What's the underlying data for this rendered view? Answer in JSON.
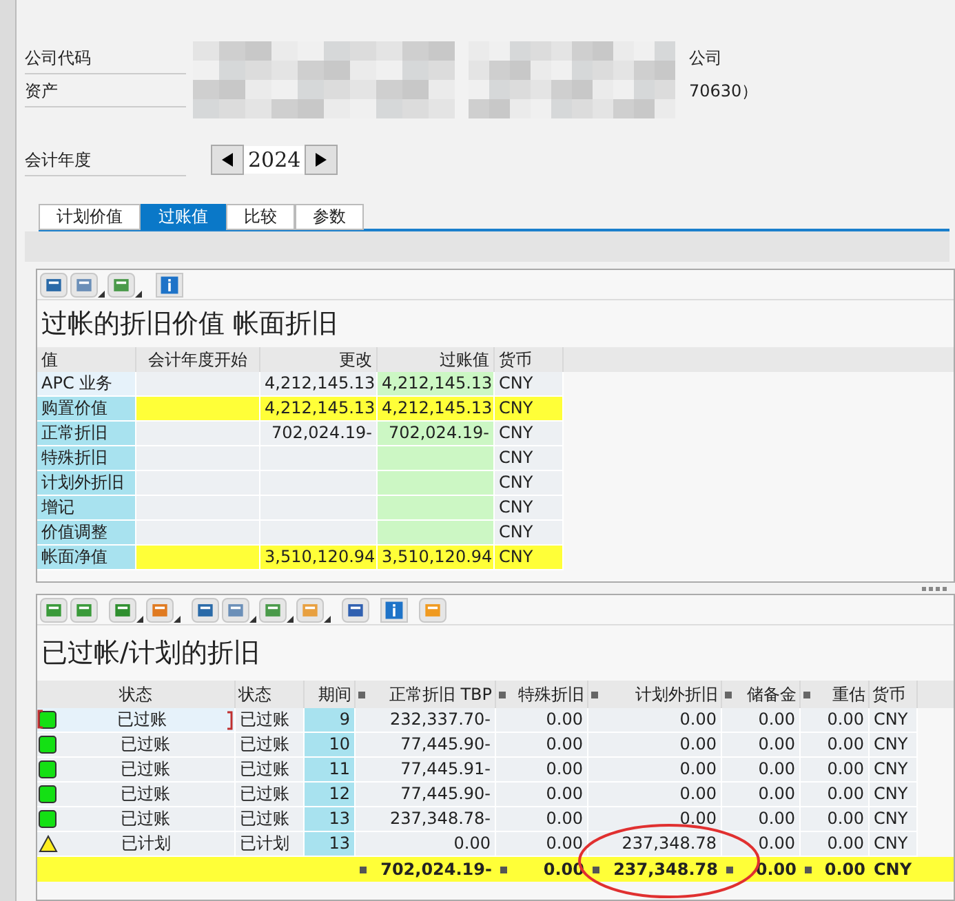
{
  "header": {
    "fields": [
      {
        "label": "公司代码",
        "value": "公司"
      },
      {
        "label": "资产",
        "value": "70630）"
      }
    ],
    "year": {
      "label": "会计年度",
      "value": "2024"
    }
  },
  "tabs": [
    {
      "label": "计划价值",
      "selected": false
    },
    {
      "label": "过账值",
      "selected": true
    },
    {
      "label": "比较",
      "selected": false
    },
    {
      "label": "参数",
      "selected": false
    }
  ],
  "values_panel": {
    "title": "过帐的折旧价值 帐面折旧",
    "columns": [
      "值",
      "会计年度开始",
      "更改",
      "过账值",
      "货币"
    ],
    "rows": [
      {
        "kind": "group",
        "highlight": false,
        "cells": [
          "APC 业务",
          "",
          "4,212,145.13",
          "4,212,145.13",
          "CNY"
        ]
      },
      {
        "kind": "value",
        "highlight": true,
        "cells": [
          "购置价值",
          "",
          "4,212,145.13",
          "4,212,145.13",
          "CNY"
        ]
      },
      {
        "kind": "value",
        "highlight": false,
        "cells": [
          "正常折旧",
          "",
          "702,024.19-",
          "702,024.19-",
          "CNY"
        ]
      },
      {
        "kind": "value",
        "highlight": false,
        "cells": [
          "特殊折旧",
          "",
          "",
          "",
          "CNY"
        ]
      },
      {
        "kind": "value",
        "highlight": false,
        "cells": [
          "计划外折旧",
          "",
          "",
          "",
          "CNY"
        ]
      },
      {
        "kind": "value",
        "highlight": false,
        "cells": [
          "增记",
          "",
          "",
          "",
          "CNY"
        ]
      },
      {
        "kind": "value",
        "highlight": false,
        "cells": [
          "价值调整",
          "",
          "",
          "",
          "CNY"
        ]
      },
      {
        "kind": "value",
        "highlight": true,
        "cells": [
          "帐面净值",
          "",
          "3,510,120.94",
          "3,510,120.94",
          "CNY"
        ]
      }
    ]
  },
  "depreciation_panel": {
    "title": "已过帐/计划的折旧",
    "columns": [
      {
        "label": "状态",
        "sum": false
      },
      {
        "label": "状态",
        "sum": false
      },
      {
        "label": "期间",
        "sum": false
      },
      {
        "label": "正常折旧 TBP",
        "sum": true
      },
      {
        "label": "特殊折旧",
        "sum": true
      },
      {
        "label": "计划外折旧",
        "sum": true
      },
      {
        "label": "储备金",
        "sum": true
      },
      {
        "label": "重估",
        "sum": true
      },
      {
        "label": "货币",
        "sum": false
      }
    ],
    "rows": [
      {
        "kind": "posted",
        "selected": true,
        "cells": [
          "已过账",
          "已过账",
          "9",
          "232,337.70-",
          "0.00",
          "0.00",
          "0.00",
          "0.00",
          "CNY"
        ]
      },
      {
        "kind": "posted",
        "selected": false,
        "cells": [
          "已过账",
          "已过账",
          "10",
          "77,445.90-",
          "0.00",
          "0.00",
          "0.00",
          "0.00",
          "CNY"
        ]
      },
      {
        "kind": "posted",
        "selected": false,
        "cells": [
          "已过账",
          "已过账",
          "11",
          "77,445.91-",
          "0.00",
          "0.00",
          "0.00",
          "0.00",
          "CNY"
        ]
      },
      {
        "kind": "posted",
        "selected": false,
        "cells": [
          "已过账",
          "已过账",
          "12",
          "77,445.90-",
          "0.00",
          "0.00",
          "0.00",
          "0.00",
          "CNY"
        ]
      },
      {
        "kind": "posted",
        "selected": false,
        "cells": [
          "已过账",
          "已过账",
          "13",
          "237,348.78-",
          "0.00",
          "0.00",
          "0.00",
          "0.00",
          "CNY"
        ]
      },
      {
        "kind": "planned",
        "selected": false,
        "cells": [
          "已计划",
          "已计划",
          "13",
          "0.00",
          "0.00",
          "237,348.78",
          "0.00",
          "0.00",
          "CNY"
        ]
      }
    ],
    "total": [
      "702,024.19-",
      "0.00",
      "237,348.78",
      "0.00",
      "0.00",
      "CNY"
    ]
  }
}
